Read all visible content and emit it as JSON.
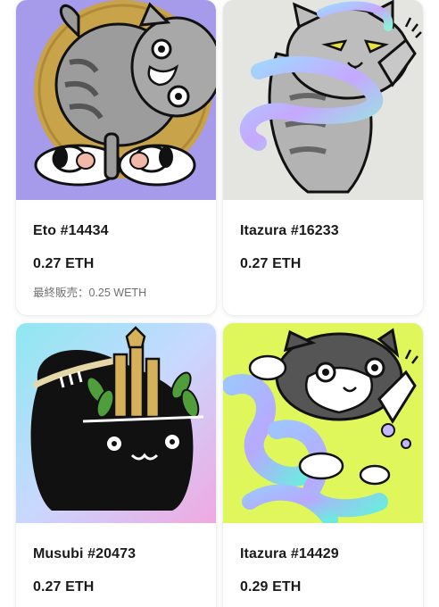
{
  "cards": [
    {
      "name": "Eto #14434",
      "price": "0.27 ETH",
      "last_sale": "最終販売：0.25 WETH",
      "image": "cat-with-dogs-art"
    },
    {
      "name": "Itazura #16233",
      "price": "0.27 ETH",
      "last_sale": "",
      "image": "cat-with-snake-art"
    },
    {
      "name": "Musubi #20473",
      "price": "0.27 ETH",
      "last_sale": "",
      "image": "black-cat-kadomatsu-art"
    },
    {
      "name": "Itazura #14429",
      "price": "0.29 ETH",
      "last_sale": "",
      "image": "cat-with-waves-art"
    }
  ],
  "colors": {
    "card1_bg": "#a59bea",
    "card1_circle": "#c8a34a",
    "card2_bg": "#e4e4e0",
    "card3_bg_a": "#8ee8f0",
    "card3_bg_b": "#f0a8e0",
    "card4_bg": "#dff75a"
  }
}
